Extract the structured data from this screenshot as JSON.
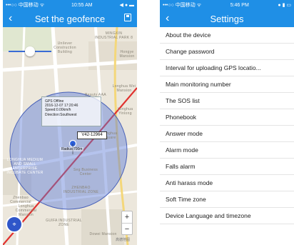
{
  "left_screen": {
    "status": {
      "carrier": "•••○○ 中国移动 ᯤ",
      "time": "10:55 AM",
      "icons": "◀ ● ▬"
    },
    "title": "Set the geofence",
    "map_labels": [
      "MINGXIN INDUSTRIAL PARK 8",
      "Unilever Construction Building",
      "Hongye Mansion",
      "Beauty AAA",
      "Longhua Wei Mansion",
      "Longhua Yinlong",
      "LONGHUA MEDIUM AND SMALL ENTERPRISE INCUBATE CENTER",
      "Zhenbao Commercial",
      "ZHENBAO INDUSTRIAL ZONE",
      "GUIFA INDUSTRIAL ZONE",
      "Dowei Mansion",
      "Longhua Square",
      "Seg Business Center",
      "Longhua Commercial Mansion"
    ],
    "popup": {
      "line1": "GPS Offline",
      "line2": "2016-12-07 17:20:46",
      "line3": "Speed:0.00km/h",
      "line4": "Direction:Southwest"
    },
    "plate": "V42-12964",
    "radius_label": "Radius:700m",
    "slider_value": 0.5,
    "zoom_in": "+",
    "zoom_out": "−",
    "watermark": "高德地图"
  },
  "right_screen": {
    "status": {
      "carrier": "•••○○ 中国移动 ᯤ",
      "time": "5:46 PM",
      "icons": "● ▮ ▭"
    },
    "title": "Settings",
    "items": [
      "About the device",
      "Change password",
      "Interval for uploading GPS locatio...",
      "Main monitoring number",
      "The SOS list",
      "Phonebook",
      "Answer mode",
      "Alarm mode",
      "Falls alarm",
      "Anti harass mode",
      "Soft Time zone",
      "Device Language and timezone"
    ]
  },
  "colors": {
    "nav": "#1f8fe6",
    "geofence": "#5b7bd6",
    "track": "#e0322f"
  }
}
